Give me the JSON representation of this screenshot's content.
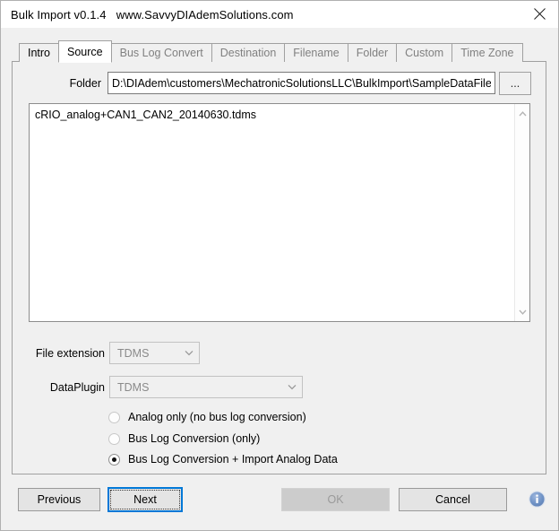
{
  "window": {
    "title": "Bulk Import v0.1.4   www.SavvyDIAdemSolutions.com",
    "close_icon": "close-icon"
  },
  "tabs": [
    {
      "label": "Intro",
      "state": "enabled",
      "active": false
    },
    {
      "label": "Source",
      "state": "enabled",
      "active": true
    },
    {
      "label": "Bus Log Convert",
      "state": "disabled",
      "active": false
    },
    {
      "label": "Destination",
      "state": "disabled",
      "active": false
    },
    {
      "label": "Filename",
      "state": "disabled",
      "active": false
    },
    {
      "label": "Folder",
      "state": "disabled",
      "active": false
    },
    {
      "label": "Custom",
      "state": "disabled",
      "active": false
    },
    {
      "label": "Time Zone",
      "state": "disabled",
      "active": false
    }
  ],
  "source": {
    "folder_label": "Folder",
    "folder_value": "D:\\DIAdem\\customers\\MechatronicSolutionsLLC\\BulkImport\\SampleDataFiles\\",
    "browse_label": "...",
    "files": [
      "cRIO_analog+CAN1_CAN2_20140630.tdms"
    ],
    "scroll_up_icon": "chevron-up-icon",
    "scroll_down_icon": "chevron-down-icon",
    "file_extension_label": "File extension",
    "file_extension_value": "TDMS",
    "dataplugin_label": "DataPlugin",
    "dataplugin_value": "TDMS",
    "dropdown_icon": "chevron-down-icon",
    "radio_options": [
      {
        "label": "Analog only (no bus log conversion)",
        "selected": false
      },
      {
        "label": "Bus Log Conversion (only)",
        "selected": false
      },
      {
        "label": "Bus Log Conversion + Import Analog Data",
        "selected": true
      }
    ]
  },
  "footer": {
    "previous_label": "Previous",
    "next_label": "Next",
    "ok_label": "OK",
    "cancel_label": "Cancel",
    "info_icon": "info-icon",
    "info_glyph": "i"
  },
  "colors": {
    "focus_blue": "#0078d7",
    "window_bg": "#f0f0f0",
    "info_blue": "#6c8fc4"
  }
}
